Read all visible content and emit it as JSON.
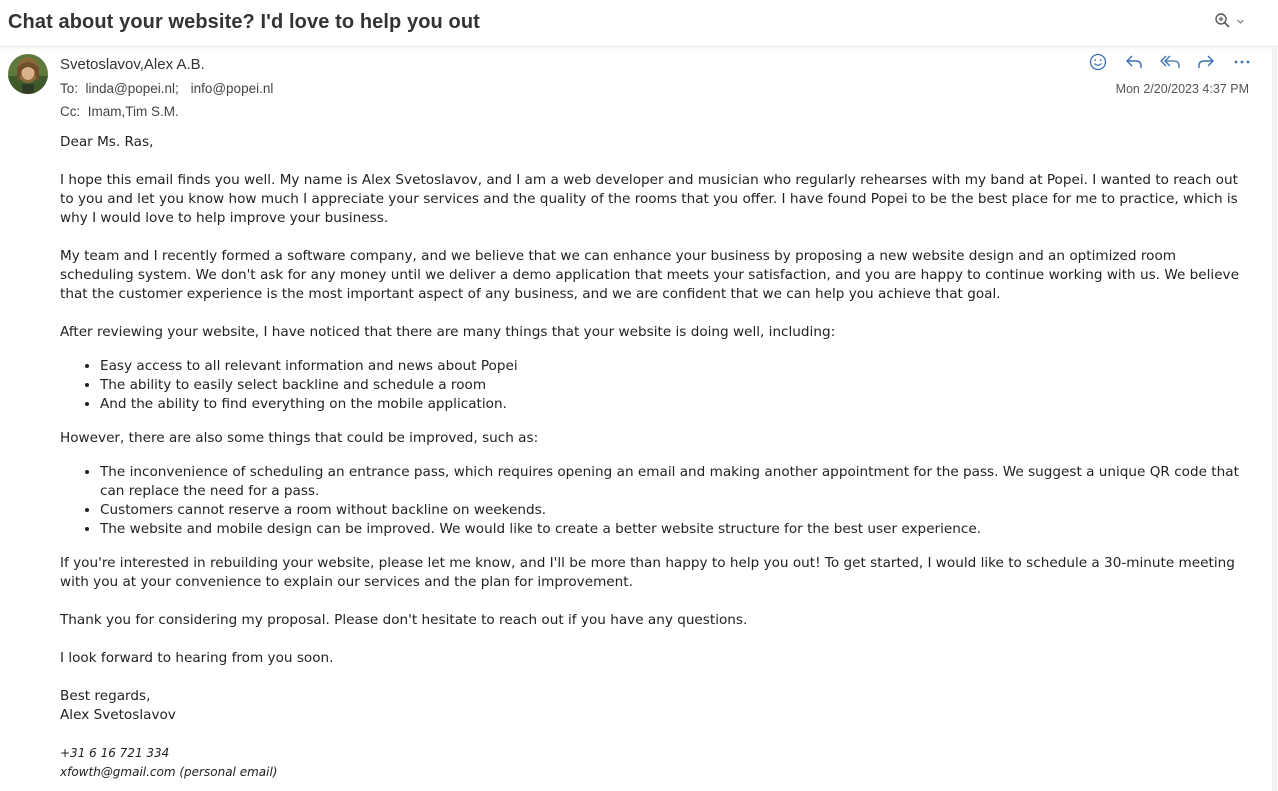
{
  "subject": "Chat about your website? I'd love to help you out",
  "header": {
    "from": "Svetoslavov,Alex A.B.",
    "to_label": "To:",
    "to": [
      "linda@popei.nl;",
      "info@popei.nl"
    ],
    "cc_label": "Cc:",
    "cc": "Imam,Tim S.M.",
    "date": "Mon 2/20/2023 4:37 PM"
  },
  "icons": {
    "zoom": "zoom-icon",
    "emoji": "emoji-icon",
    "reply": "reply-icon",
    "reply_all": "reply-all-icon",
    "forward": "forward-icon",
    "more": "more-icon"
  },
  "body": {
    "greeting": "Dear Ms. Ras,",
    "p1": "I hope this email finds you well. My name is Alex Svetoslavov, and I am a web developer and musician who regularly rehearses with my band at Popei. I wanted to reach out to you and let you know how much I appreciate your services and the quality of the rooms that you offer. I have found Popei to be the best place for me to practice, which is why I would love to help improve your business.",
    "p2": "My team and I recently formed a software company, and we believe that we can enhance your business by proposing a new website design and an optimized room scheduling system. We don't ask for any money until we deliver a demo application that meets your satisfaction, and you are happy to continue working with us. We believe that the customer experience is the most important aspect of any business, and we are confident that we can help you achieve that goal.",
    "p3": "After reviewing your website, I have noticed that there are many things that your website is doing well, including:",
    "list1": [
      "Easy access to all relevant information and news about Popei",
      "The ability to easily select backline and schedule a room",
      "And the ability to find everything on the mobile application."
    ],
    "p4": "However, there are also some things that could be improved, such as:",
    "list2": [
      "The inconvenience of scheduling an entrance pass, which requires opening an email and making another appointment for the pass. We suggest a unique QR code that can replace the need for a pass.",
      "Customers cannot reserve a room without backline on weekends.",
      "The website and mobile design can be improved. We would like to create a better website structure for the best user experience."
    ],
    "p5": "If you're interested in rebuilding your website, please let me know, and I'll be more than happy to help you out! To get started, I would like to schedule a 30-minute meeting with you at your convenience to explain our services and the plan for improvement.",
    "p6": "Thank you for considering my proposal. Please don't hesitate to reach out if you have any questions.",
    "p7": "I look forward to hearing from you soon.",
    "closing": "Best regards,",
    "name": "Alex Svetoslavov",
    "phone": "+31 6 16 721 334",
    "email": "xfowth@gmail.com (personal email)"
  }
}
